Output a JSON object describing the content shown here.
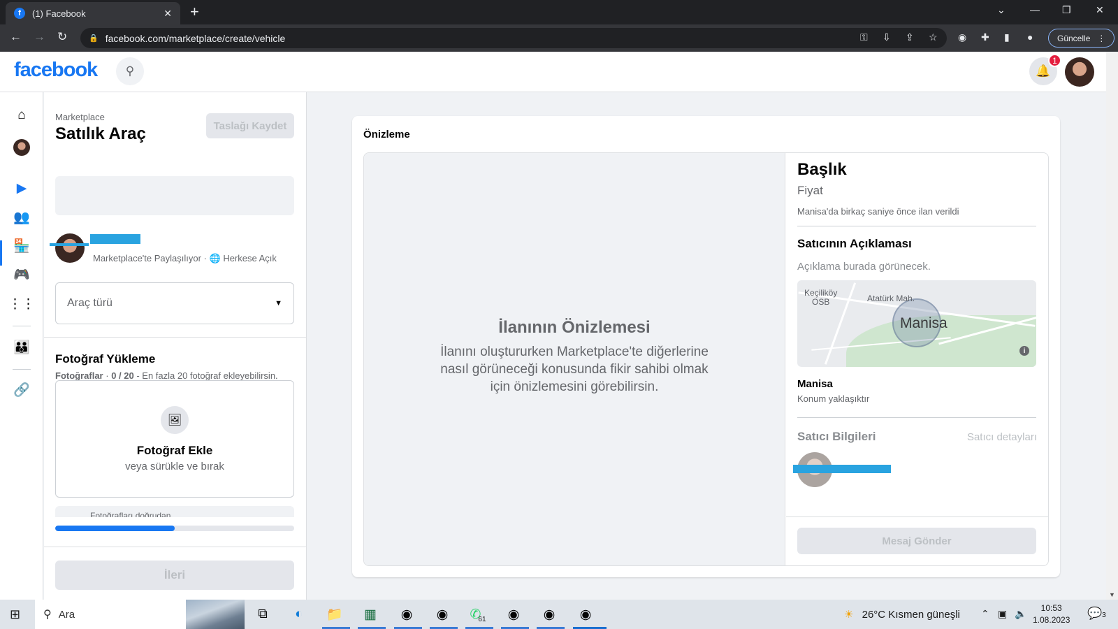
{
  "browser": {
    "tab_title": "(1) Facebook",
    "url": "facebook.com/marketplace/create/vehicle",
    "update_label": "Güncelle"
  },
  "fb": {
    "logo": "facebook",
    "notification_count": "1"
  },
  "panel": {
    "breadcrumb": "Marketplace",
    "title": "Satılık Araç",
    "save_draft": "Taslağı Kaydet",
    "sharing": "Marketplace'te Paylaşılıyor · ",
    "audience": "Herkese Açık",
    "vehicle_type_placeholder": "Araç türü",
    "photo_section_title": "Fotoğraf Yükleme",
    "photo_label": "Fotoğraflar",
    "photo_count": "0 / 20",
    "photo_hint": " - En fazla 20 fotoğraf ekleyebilirsin.",
    "add_photo": "Fotoğraf Ekle",
    "drag_drop": "veya sürükle ve bırak",
    "cutoff_text": "Fotoğrafları doğrudan",
    "progress": 0.5,
    "next": "İleri"
  },
  "preview": {
    "title": "Önizleme",
    "heading": "İlanının Önizlemesi",
    "body": "İlanını oluştururken Marketplace'te diğerlerine nasıl görüneceği konusunda fikir sahibi olmak için önizlemesini görebilirsin.",
    "listing_title": "Başlık",
    "price": "Fiyat",
    "posted": "Manisa'da birkaç saniye önce ilan verildi",
    "desc_title": "Satıcının Açıklaması",
    "desc": "Açıklama burada görünecek.",
    "map": {
      "label1": "Keçiliköy\nOSB",
      "label2": "Atatürk Mah.",
      "city": "Manisa"
    },
    "location": "Manisa",
    "location_note": "Konum yaklaşıktır",
    "seller_info": "Satıcı Bilgileri",
    "seller_details": "Satıcı detayları",
    "send_message": "Mesaj Gönder"
  },
  "taskbar": {
    "search_placeholder": "Ara",
    "whatsapp_badge": "61",
    "weather": "26°C  Kısmen güneşli",
    "time": "10:53",
    "date": "1.08.2023",
    "notif_count": "3"
  },
  "colors": {
    "brand": "#1877f2",
    "redaction": "#29a3e0"
  }
}
